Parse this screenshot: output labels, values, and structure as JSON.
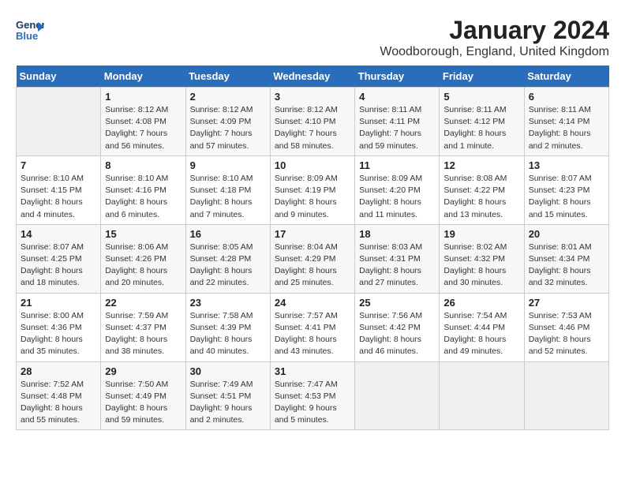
{
  "logo": {
    "line1": "General",
    "line2": "Blue"
  },
  "calendar": {
    "title": "January 2024",
    "subtitle": "Woodborough, England, United Kingdom"
  },
  "headers": [
    "Sunday",
    "Monday",
    "Tuesday",
    "Wednesday",
    "Thursday",
    "Friday",
    "Saturday"
  ],
  "weeks": [
    [
      {
        "day": "",
        "info": ""
      },
      {
        "day": "1",
        "info": "Sunrise: 8:12 AM\nSunset: 4:08 PM\nDaylight: 7 hours\nand 56 minutes."
      },
      {
        "day": "2",
        "info": "Sunrise: 8:12 AM\nSunset: 4:09 PM\nDaylight: 7 hours\nand 57 minutes."
      },
      {
        "day": "3",
        "info": "Sunrise: 8:12 AM\nSunset: 4:10 PM\nDaylight: 7 hours\nand 58 minutes."
      },
      {
        "day": "4",
        "info": "Sunrise: 8:11 AM\nSunset: 4:11 PM\nDaylight: 7 hours\nand 59 minutes."
      },
      {
        "day": "5",
        "info": "Sunrise: 8:11 AM\nSunset: 4:12 PM\nDaylight: 8 hours\nand 1 minute."
      },
      {
        "day": "6",
        "info": "Sunrise: 8:11 AM\nSunset: 4:14 PM\nDaylight: 8 hours\nand 2 minutes."
      }
    ],
    [
      {
        "day": "7",
        "info": "Sunrise: 8:10 AM\nSunset: 4:15 PM\nDaylight: 8 hours\nand 4 minutes."
      },
      {
        "day": "8",
        "info": "Sunrise: 8:10 AM\nSunset: 4:16 PM\nDaylight: 8 hours\nand 6 minutes."
      },
      {
        "day": "9",
        "info": "Sunrise: 8:10 AM\nSunset: 4:18 PM\nDaylight: 8 hours\nand 7 minutes."
      },
      {
        "day": "10",
        "info": "Sunrise: 8:09 AM\nSunset: 4:19 PM\nDaylight: 8 hours\nand 9 minutes."
      },
      {
        "day": "11",
        "info": "Sunrise: 8:09 AM\nSunset: 4:20 PM\nDaylight: 8 hours\nand 11 minutes."
      },
      {
        "day": "12",
        "info": "Sunrise: 8:08 AM\nSunset: 4:22 PM\nDaylight: 8 hours\nand 13 minutes."
      },
      {
        "day": "13",
        "info": "Sunrise: 8:07 AM\nSunset: 4:23 PM\nDaylight: 8 hours\nand 15 minutes."
      }
    ],
    [
      {
        "day": "14",
        "info": "Sunrise: 8:07 AM\nSunset: 4:25 PM\nDaylight: 8 hours\nand 18 minutes."
      },
      {
        "day": "15",
        "info": "Sunrise: 8:06 AM\nSunset: 4:26 PM\nDaylight: 8 hours\nand 20 minutes."
      },
      {
        "day": "16",
        "info": "Sunrise: 8:05 AM\nSunset: 4:28 PM\nDaylight: 8 hours\nand 22 minutes."
      },
      {
        "day": "17",
        "info": "Sunrise: 8:04 AM\nSunset: 4:29 PM\nDaylight: 8 hours\nand 25 minutes."
      },
      {
        "day": "18",
        "info": "Sunrise: 8:03 AM\nSunset: 4:31 PM\nDaylight: 8 hours\nand 27 minutes."
      },
      {
        "day": "19",
        "info": "Sunrise: 8:02 AM\nSunset: 4:32 PM\nDaylight: 8 hours\nand 30 minutes."
      },
      {
        "day": "20",
        "info": "Sunrise: 8:01 AM\nSunset: 4:34 PM\nDaylight: 8 hours\nand 32 minutes."
      }
    ],
    [
      {
        "day": "21",
        "info": "Sunrise: 8:00 AM\nSunset: 4:36 PM\nDaylight: 8 hours\nand 35 minutes."
      },
      {
        "day": "22",
        "info": "Sunrise: 7:59 AM\nSunset: 4:37 PM\nDaylight: 8 hours\nand 38 minutes."
      },
      {
        "day": "23",
        "info": "Sunrise: 7:58 AM\nSunset: 4:39 PM\nDaylight: 8 hours\nand 40 minutes."
      },
      {
        "day": "24",
        "info": "Sunrise: 7:57 AM\nSunset: 4:41 PM\nDaylight: 8 hours\nand 43 minutes."
      },
      {
        "day": "25",
        "info": "Sunrise: 7:56 AM\nSunset: 4:42 PM\nDaylight: 8 hours\nand 46 minutes."
      },
      {
        "day": "26",
        "info": "Sunrise: 7:54 AM\nSunset: 4:44 PM\nDaylight: 8 hours\nand 49 minutes."
      },
      {
        "day": "27",
        "info": "Sunrise: 7:53 AM\nSunset: 4:46 PM\nDaylight: 8 hours\nand 52 minutes."
      }
    ],
    [
      {
        "day": "28",
        "info": "Sunrise: 7:52 AM\nSunset: 4:48 PM\nDaylight: 8 hours\nand 55 minutes."
      },
      {
        "day": "29",
        "info": "Sunrise: 7:50 AM\nSunset: 4:49 PM\nDaylight: 8 hours\nand 59 minutes."
      },
      {
        "day": "30",
        "info": "Sunrise: 7:49 AM\nSunset: 4:51 PM\nDaylight: 9 hours\nand 2 minutes."
      },
      {
        "day": "31",
        "info": "Sunrise: 7:47 AM\nSunset: 4:53 PM\nDaylight: 9 hours\nand 5 minutes."
      },
      {
        "day": "",
        "info": ""
      },
      {
        "day": "",
        "info": ""
      },
      {
        "day": "",
        "info": ""
      }
    ]
  ]
}
